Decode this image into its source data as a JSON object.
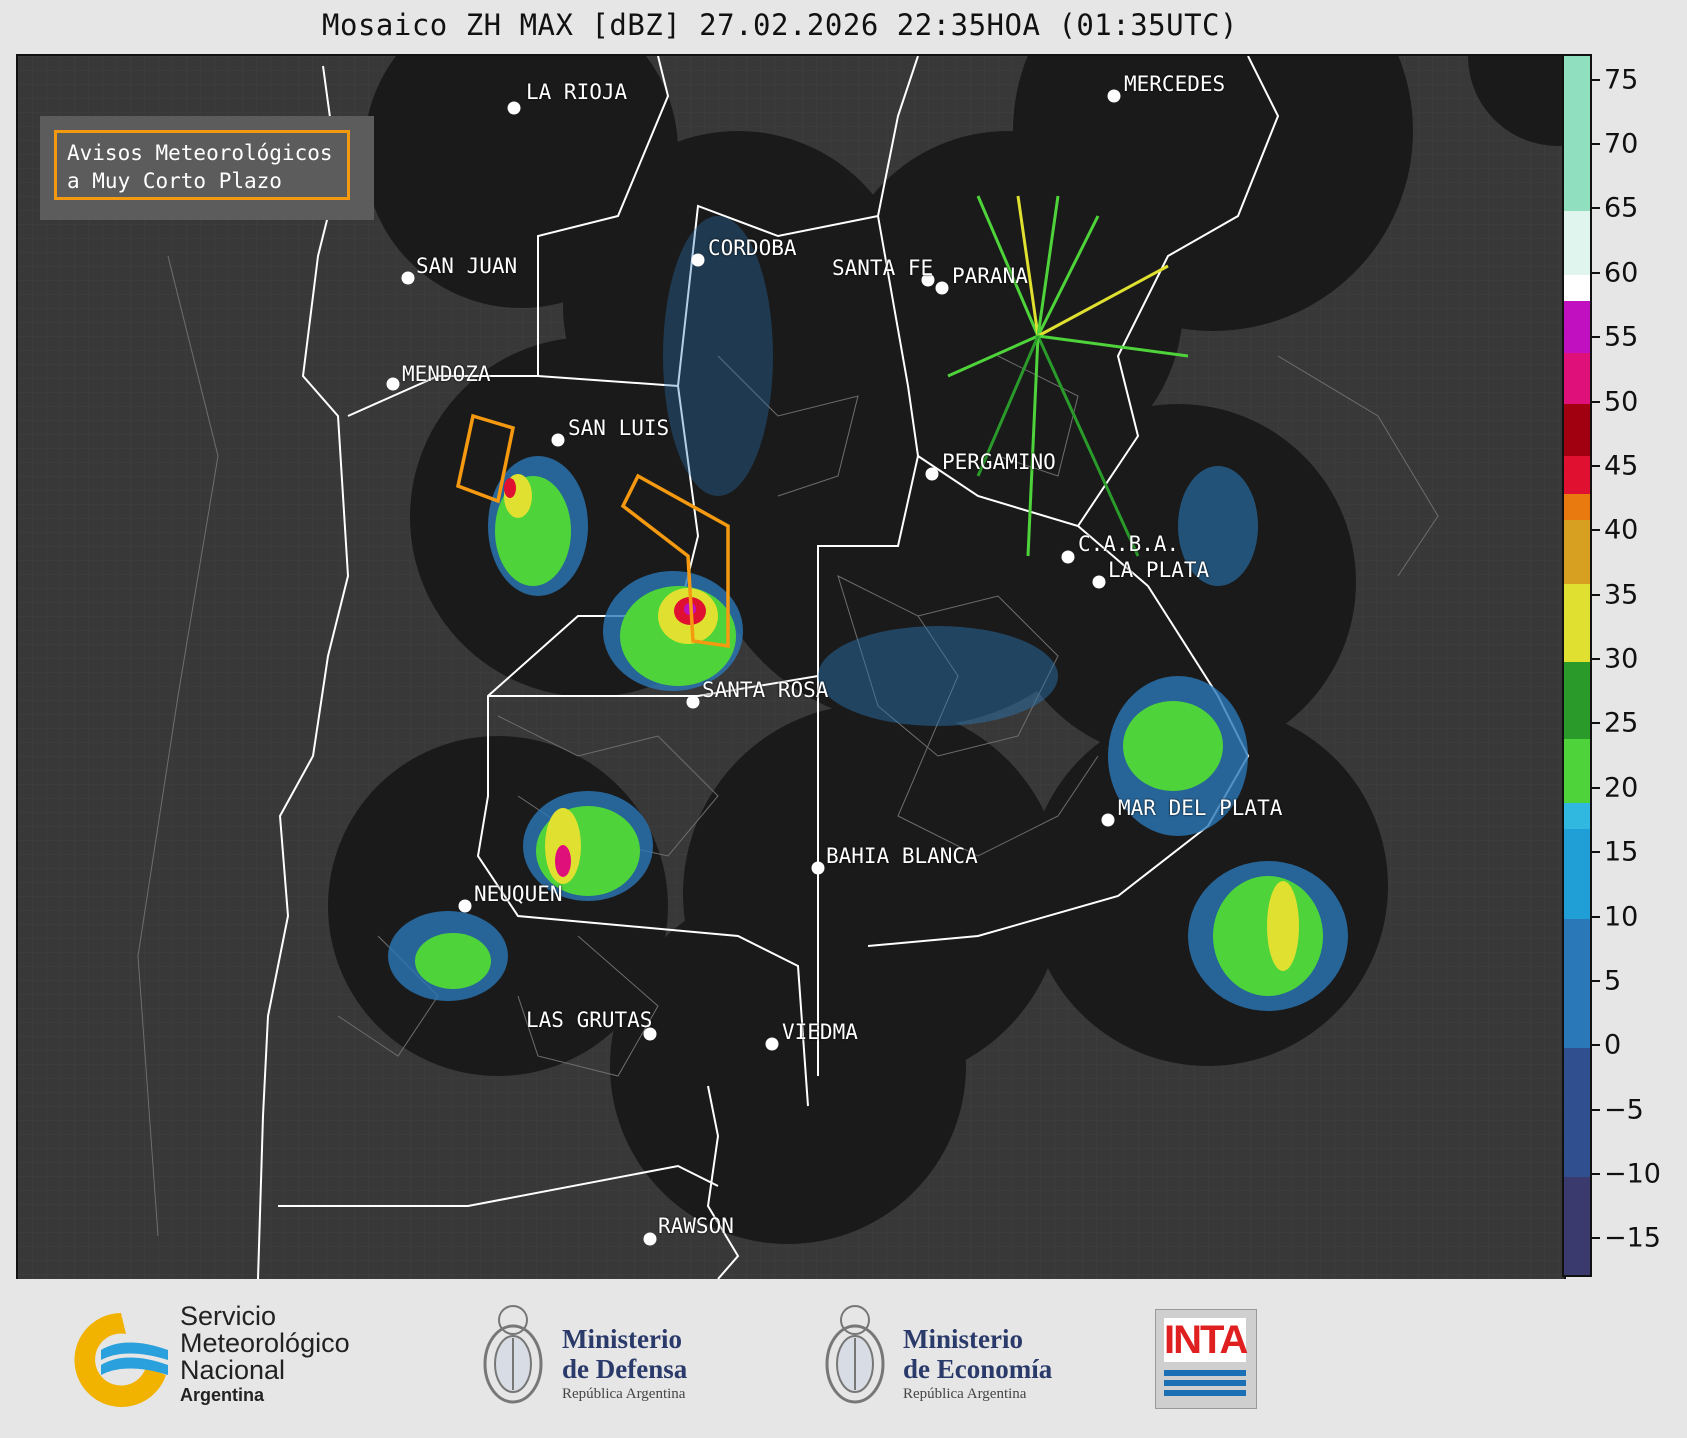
{
  "title": "Mosaico ZH MAX [dBZ] 27.02.2026 22:35HOA (01:35UTC)",
  "legend": {
    "line1": "Avisos Meteorológicos",
    "line2": "a Muy Corto Plazo",
    "color": "#f59a10"
  },
  "cities": [
    {
      "name": "LA RIOJA"
    },
    {
      "name": "MERCEDES"
    },
    {
      "name": "CORDOBA"
    },
    {
      "name": "SAN JUAN"
    },
    {
      "name": "SANTA FE"
    },
    {
      "name": "PARANA"
    },
    {
      "name": "MENDOZA"
    },
    {
      "name": "SAN LUIS"
    },
    {
      "name": "PERGAMINO"
    },
    {
      "name": "C.A.B.A."
    },
    {
      "name": "LA PLATA"
    },
    {
      "name": "SANTA ROSA"
    },
    {
      "name": "MAR DEL PLATA"
    },
    {
      "name": "BAHIA BLANCA"
    },
    {
      "name": "NEUQUEN"
    },
    {
      "name": "LAS GRUTAS"
    },
    {
      "name": "VIEDMA"
    },
    {
      "name": "RAWSON"
    }
  ],
  "colorbar": {
    "unit": "dBZ",
    "min": -18,
    "max": 77,
    "ticks": [
      "75",
      "70",
      "65",
      "60",
      "55",
      "50",
      "45",
      "40",
      "35",
      "30",
      "25",
      "20",
      "15",
      "10",
      "5",
      "0",
      "−5",
      "−10",
      "−15"
    ],
    "tick_values": [
      75,
      70,
      65,
      60,
      55,
      50,
      45,
      40,
      35,
      30,
      25,
      20,
      15,
      10,
      5,
      0,
      -5,
      -10,
      -15
    ],
    "bands": [
      {
        "from": -18,
        "to": -10,
        "color": "#3a3a6e"
      },
      {
        "from": -10,
        "to": 0,
        "color": "#2f4f8f"
      },
      {
        "from": 0,
        "to": 10,
        "color": "#2a78b8"
      },
      {
        "from": 10,
        "to": 17,
        "color": "#1f9fd6"
      },
      {
        "from": 17,
        "to": 19,
        "color": "#30b8e0"
      },
      {
        "from": 19,
        "to": 24,
        "color": "#4ed43a"
      },
      {
        "from": 24,
        "to": 30,
        "color": "#2a9a2a"
      },
      {
        "from": 30,
        "to": 36,
        "color": "#e0e030"
      },
      {
        "from": 36,
        "to": 41,
        "color": "#d8a020"
      },
      {
        "from": 41,
        "to": 43,
        "color": "#e87a10"
      },
      {
        "from": 43,
        "to": 46,
        "color": "#e01030"
      },
      {
        "from": 46,
        "to": 50,
        "color": "#a00010"
      },
      {
        "from": 50,
        "to": 54,
        "color": "#e0107a"
      },
      {
        "from": 54,
        "to": 58,
        "color": "#c010c0"
      },
      {
        "from": 58,
        "to": 60,
        "color": "#ffffff"
      },
      {
        "from": 60,
        "to": 65,
        "color": "#e0f5ee"
      },
      {
        "from": 65,
        "to": 77,
        "color": "#90e0c0"
      }
    ]
  },
  "footer": {
    "smn": {
      "line1": "Servicio",
      "line2": "Meteorológico",
      "line3": "Nacional",
      "line4": "Argentina"
    },
    "defensa": {
      "line1": "Ministerio",
      "line2": "de Defensa",
      "line3": "República Argentina"
    },
    "economia": {
      "line1": "Ministerio",
      "line2": "de Economía",
      "line3": "República Argentina"
    },
    "inta": "INTA"
  }
}
